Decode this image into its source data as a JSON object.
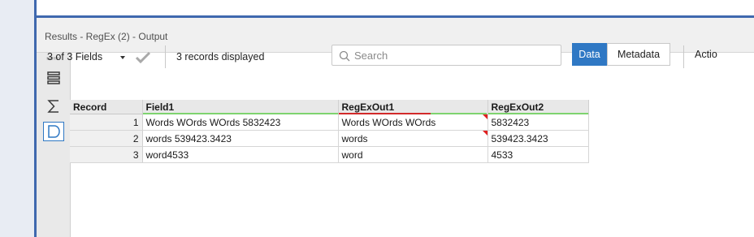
{
  "results": {
    "title": "Results - RegEx (2) - Output"
  },
  "toolbar": {
    "fields_selector": "3 of 3 Fields",
    "records_displayed": "3 records displayed",
    "search_placeholder": "Search",
    "view_tabs": {
      "data": "Data",
      "metadata": "Metadata"
    },
    "actions_partial": "Actio"
  },
  "side_toolbar": {
    "icons": [
      "list-view-icon",
      "summary-sigma-icon",
      "data-view-icon"
    ]
  },
  "table": {
    "columns": [
      "Record",
      "Field1",
      "RegExOut1",
      "RegExOut2"
    ],
    "rows": [
      {
        "record": "1",
        "field1": "Words WOrds WOrds 5832423",
        "out1": "Words WOrds WOrds",
        "out2": "5832423"
      },
      {
        "record": "2",
        "field1": "words 539423.3423",
        "out1": "words",
        "out2": "539423.3423"
      },
      {
        "record": "3",
        "field1": "word4533",
        "out1": "word",
        "out2": "4533"
      }
    ],
    "truncation_flags": {
      "row1_out1": true,
      "row2_out1": true
    },
    "colors": {
      "header_ok_underline": "#7ed36f",
      "header_warn_underline": "#d22a2a",
      "flag": "#e02020",
      "accent": "#2f78c4"
    }
  }
}
